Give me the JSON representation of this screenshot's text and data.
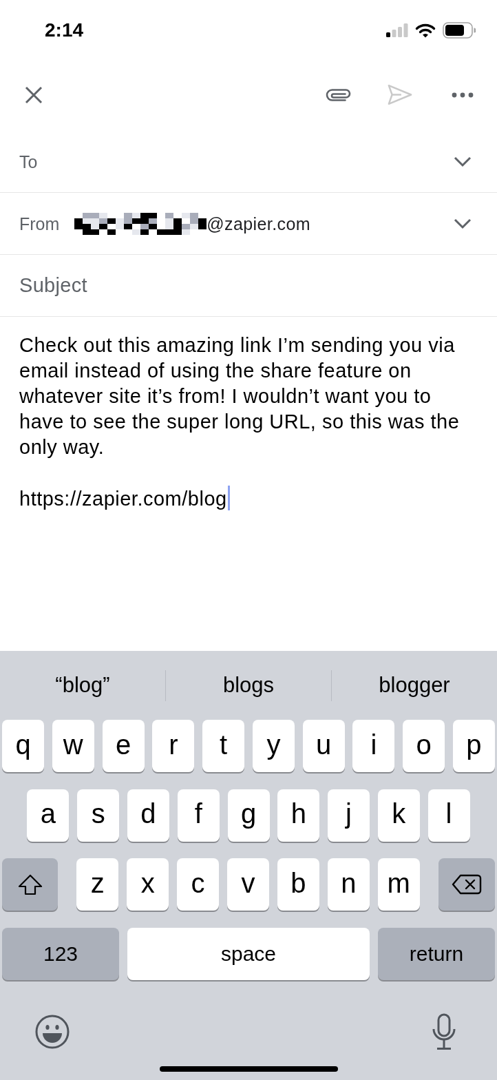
{
  "status_bar": {
    "time": "2:14"
  },
  "toolbar": [
    {
      "kind": "close",
      "disabled": false
    },
    {
      "kind": "attach",
      "disabled": false
    },
    {
      "kind": "send",
      "disabled": true
    },
    {
      "kind": "more",
      "disabled": false
    }
  ],
  "fields": [
    {
      "kind": "recipients",
      "label": "To"
    },
    {
      "kind": "sender",
      "label": "From",
      "value": "@zapier.com",
      "redacted": true
    },
    {
      "kind": "subject",
      "placeholder": "Subject"
    }
  ],
  "body": {
    "paragraphs": [
      "Check out this amazing link I’m sending you via email instead of using the share feature on whatever site it’s from! I wouldn’t want you to have to see the super long URL, so this was the only way.",
      "https://zapier.com/blog"
    ],
    "focused": true
  },
  "keyboard": {
    "suggestions": [
      "“blog”",
      "blogs",
      "blogger"
    ],
    "rows": [
      {
        "keys": [
          {
            "kind": "letter",
            "label": "q"
          },
          {
            "kind": "letter",
            "label": "w"
          },
          {
            "kind": "letter",
            "label": "e"
          },
          {
            "kind": "letter",
            "label": "r"
          },
          {
            "kind": "letter",
            "label": "t"
          },
          {
            "kind": "letter",
            "label": "y"
          },
          {
            "kind": "letter",
            "label": "u"
          },
          {
            "kind": "letter",
            "label": "i"
          },
          {
            "kind": "letter",
            "label": "o"
          },
          {
            "kind": "letter",
            "label": "p"
          }
        ]
      },
      {
        "keys": [
          {
            "kind": "letter",
            "label": "a"
          },
          {
            "kind": "letter",
            "label": "s"
          },
          {
            "kind": "letter",
            "label": "d"
          },
          {
            "kind": "letter",
            "label": "f"
          },
          {
            "kind": "letter",
            "label": "g"
          },
          {
            "kind": "letter",
            "label": "h"
          },
          {
            "kind": "letter",
            "label": "j"
          },
          {
            "kind": "letter",
            "label": "k"
          },
          {
            "kind": "letter",
            "label": "l"
          }
        ]
      },
      {
        "keys": [
          {
            "kind": "shift"
          },
          {
            "kind": "letter",
            "label": "z"
          },
          {
            "kind": "letter",
            "label": "x"
          },
          {
            "kind": "letter",
            "label": "c"
          },
          {
            "kind": "letter",
            "label": "v"
          },
          {
            "kind": "letter",
            "label": "b"
          },
          {
            "kind": "letter",
            "label": "n"
          },
          {
            "kind": "letter",
            "label": "m"
          },
          {
            "kind": "backspace"
          }
        ]
      },
      {
        "keys": [
          {
            "kind": "mode",
            "label": "123"
          },
          {
            "kind": "space",
            "label": "space"
          },
          {
            "kind": "return",
            "label": "return"
          }
        ]
      }
    ],
    "bottom": [
      {
        "kind": "emoji"
      },
      {
        "kind": "dictation"
      }
    ]
  }
}
